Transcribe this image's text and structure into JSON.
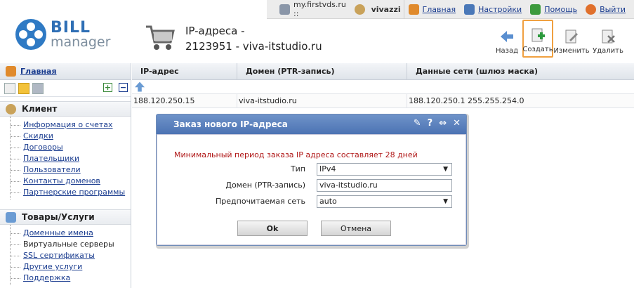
{
  "topbar": {
    "host": "my.firstvds.ru ::",
    "user": "vivazzi",
    "links": [
      {
        "label": "Главная",
        "icon": "home-icon"
      },
      {
        "label": "Настройки",
        "icon": "settings-icon"
      },
      {
        "label": "Помощь",
        "icon": "help-icon"
      },
      {
        "label": "Выйти",
        "icon": "logout-icon"
      }
    ]
  },
  "logo": {
    "line1": "BILL",
    "line2": "manager"
  },
  "page": {
    "title_line1": "IP-адреса -",
    "title_line2": "2123951 - viva-itstudio.ru"
  },
  "toolbar": {
    "back": "Назад",
    "create": "Создать",
    "edit": "Изменить",
    "delete": "Удалить"
  },
  "sidebar": {
    "home": "Главная",
    "sections": [
      {
        "title": "Клиент",
        "items": [
          "Информация о счетах",
          "Скидки",
          "Договоры",
          "Плательщики",
          "Пользователи",
          "Контакты доменов",
          "Партнерские программы"
        ]
      },
      {
        "title": "Товары/Услуги",
        "items": [
          "Доменные имена",
          "Виртуальные серверы",
          "SSL сертификаты",
          "Другие услуги",
          "Поддержка"
        ]
      }
    ]
  },
  "table": {
    "columns": [
      "IP-адрес",
      "Домен (PTR-запись)",
      "Данные сети (шлюз маска)"
    ],
    "rows": [
      [
        "188.120.250.15",
        "viva-itstudio.ru",
        "188.120.250.1 255.255.254.0"
      ]
    ]
  },
  "dialog": {
    "title": "Заказ нового IP-адреса",
    "message": "Минимальный период заказа IP адреса составляет 28 дней",
    "fields": [
      {
        "label": "Тип",
        "value": "IPv4",
        "type": "select"
      },
      {
        "label": "Домен (PTR-запись)",
        "value": "viva-itstudio.ru",
        "type": "input"
      },
      {
        "label": "Предпочитаемая сеть",
        "value": "auto",
        "type": "select"
      }
    ],
    "ok": "Ok",
    "cancel": "Отмена"
  },
  "colors": {
    "accent": "#2f6fb5",
    "dialog_header": "#5a7fbd",
    "error": "#b01818",
    "highlight": "#f0a040"
  }
}
